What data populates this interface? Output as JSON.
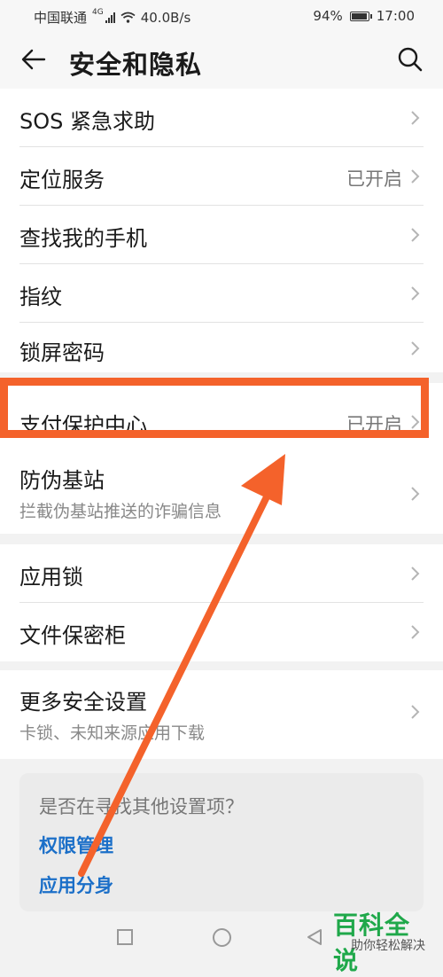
{
  "status_bar": {
    "carrier": "中国联通",
    "network": "4G",
    "speed": "40.0B/s",
    "battery_pct": "94%",
    "time": "17:00"
  },
  "header": {
    "title": "安全和隐私",
    "back_icon": "arrow-left-icon",
    "search_icon": "search-icon"
  },
  "section1": {
    "items": [
      {
        "label": "SOS 紧急求助"
      },
      {
        "label": "定位服务",
        "value": "已开启"
      },
      {
        "label": "查找我的手机"
      },
      {
        "label": "指纹"
      },
      {
        "label": "锁屏密码"
      }
    ]
  },
  "section2": {
    "items": [
      {
        "label": "支付保护中心",
        "value": "已开启"
      },
      {
        "label": "防伪基站",
        "sub": "拦截伪基站推送的诈骗信息"
      }
    ]
  },
  "section3": {
    "items": [
      {
        "label": "应用锁"
      },
      {
        "label": "文件保密柜"
      }
    ]
  },
  "section4": {
    "items": [
      {
        "label": "更多安全设置",
        "sub": "卡锁、未知来源应用下载"
      }
    ]
  },
  "hint": {
    "title": "是否在寻找其他设置项？",
    "links": [
      "权限管理",
      "应用分身"
    ]
  },
  "watermark": {
    "main": "百科全说",
    "sub": "助你轻松解决"
  },
  "colors": {
    "accent": "#f4622b",
    "link": "#1b6fc8",
    "watermark": "#1fa84a"
  }
}
